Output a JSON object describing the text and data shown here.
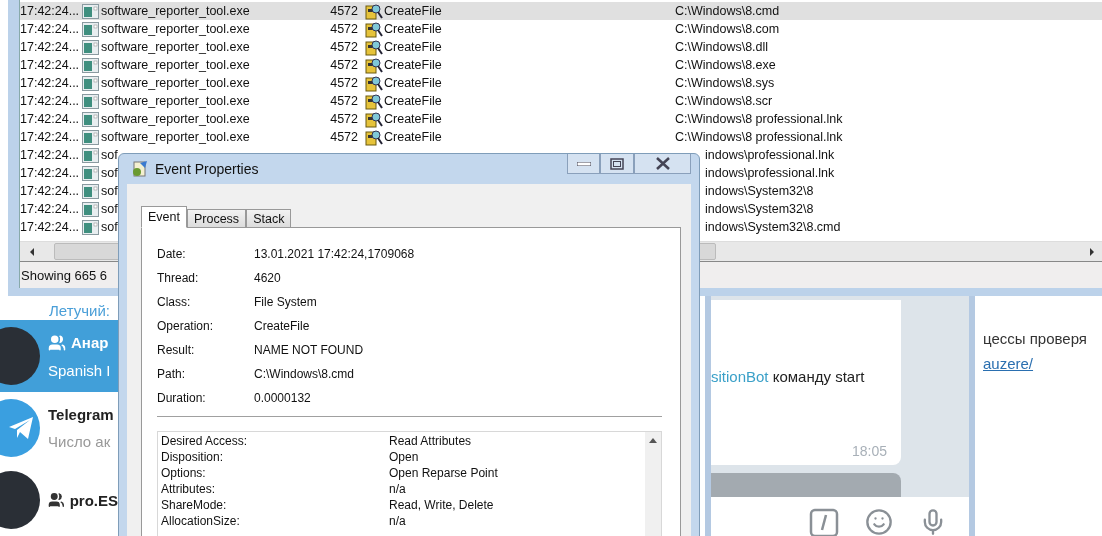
{
  "process_monitor": {
    "rows": [
      {
        "kind": "full",
        "selected": true,
        "time": "17:42:24...",
        "process": "software_reporter_tool.exe",
        "pid": "4572",
        "operation": "CreateFile",
        "path": "C:\\Windows\\8.cmd"
      },
      {
        "kind": "full",
        "selected": false,
        "time": "17:42:24...",
        "process": "software_reporter_tool.exe",
        "pid": "4572",
        "operation": "CreateFile",
        "path": "C:\\Windows\\8.com"
      },
      {
        "kind": "full",
        "selected": false,
        "time": "17:42:24...",
        "process": "software_reporter_tool.exe",
        "pid": "4572",
        "operation": "CreateFile",
        "path": "C:\\Windows\\8.dll"
      },
      {
        "kind": "full",
        "selected": false,
        "time": "17:42:24...",
        "process": "software_reporter_tool.exe",
        "pid": "4572",
        "operation": "CreateFile",
        "path": "C:\\Windows\\8.exe"
      },
      {
        "kind": "full",
        "selected": false,
        "time": "17:42:24...",
        "process": "software_reporter_tool.exe",
        "pid": "4572",
        "operation": "CreateFile",
        "path": "C:\\Windows\\8.sys"
      },
      {
        "kind": "full",
        "selected": false,
        "time": "17:42:24...",
        "process": "software_reporter_tool.exe",
        "pid": "4572",
        "operation": "CreateFile",
        "path": "C:\\Windows\\8.scr"
      },
      {
        "kind": "full",
        "selected": false,
        "time": "17:42:24...",
        "process": "software_reporter_tool.exe",
        "pid": "4572",
        "operation": "CreateFile",
        "path": "C:\\Windows\\8 professional.lnk"
      },
      {
        "kind": "full",
        "selected": false,
        "time": "17:42:24...",
        "process": "software_reporter_tool.exe",
        "pid": "4572",
        "operation": "CreateFile",
        "path": "C:\\Windows\\8 professional.lnk"
      },
      {
        "kind": "partial",
        "selected": false,
        "time": "17:42:24...",
        "process": "sof",
        "path": "indows\\professional.lnk"
      },
      {
        "kind": "partial",
        "selected": false,
        "time": "17:42:24...",
        "process": "sof",
        "path": "indows\\professional.lnk"
      },
      {
        "kind": "partial",
        "selected": false,
        "time": "17:42:24...",
        "process": "sof",
        "path": "indows\\System32\\8"
      },
      {
        "kind": "partial",
        "selected": false,
        "time": "17:42:24...",
        "process": "sof",
        "path": "indows\\System32\\8"
      },
      {
        "kind": "partial",
        "selected": false,
        "time": "17:42:24...",
        "process": "sof",
        "path": "indows\\System32\\8.cmd"
      }
    ],
    "status": "Showing 665 6"
  },
  "event_properties": {
    "title": "Event Properties",
    "tabs": [
      {
        "label": "Event",
        "selected": true
      },
      {
        "label": "Process",
        "selected": false
      },
      {
        "label": "Stack",
        "selected": false
      }
    ],
    "fields": [
      {
        "label": "Date:",
        "value": "13.01.2021 17:42:24,1709068"
      },
      {
        "label": "Thread:",
        "value": "4620"
      },
      {
        "label": "Class:",
        "value": "File System"
      },
      {
        "label": "Operation:",
        "value": "CreateFile"
      },
      {
        "label": "Result:",
        "value": "NAME NOT FOUND"
      },
      {
        "label": "Path:",
        "value": "C:\\Windows\\8.cmd"
      },
      {
        "label": "Duration:",
        "value": "0.0000132"
      }
    ],
    "details": [
      {
        "label": "Desired Access:",
        "value": "Read Attributes"
      },
      {
        "label": "Disposition:",
        "value": "Open"
      },
      {
        "label": "Options:",
        "value": "Open Reparse Point"
      },
      {
        "label": "Attributes:",
        "value": "n/a"
      },
      {
        "label": "ShareMode:",
        "value": "Read, Write, Delete"
      },
      {
        "label": "AllocationSize:",
        "value": "n/a"
      }
    ]
  },
  "telegram": {
    "preview_above": "Летучий:",
    "chats": [
      {
        "name": "Анар",
        "preview": "Spanish I",
        "group": true,
        "kind": "photo",
        "selected": true
      },
      {
        "name": "Telegram",
        "preview": "Число ак",
        "group": false,
        "kind": "logo",
        "selected": false
      },
      {
        "name": "pro.ES",
        "group": true,
        "kind": "photo",
        "selected": false
      }
    ],
    "message": {
      "link": "sitionBot",
      "text": " команду start",
      "time": "18:05"
    },
    "side_text": "цессы проверя",
    "side_link": "auzere/"
  }
}
